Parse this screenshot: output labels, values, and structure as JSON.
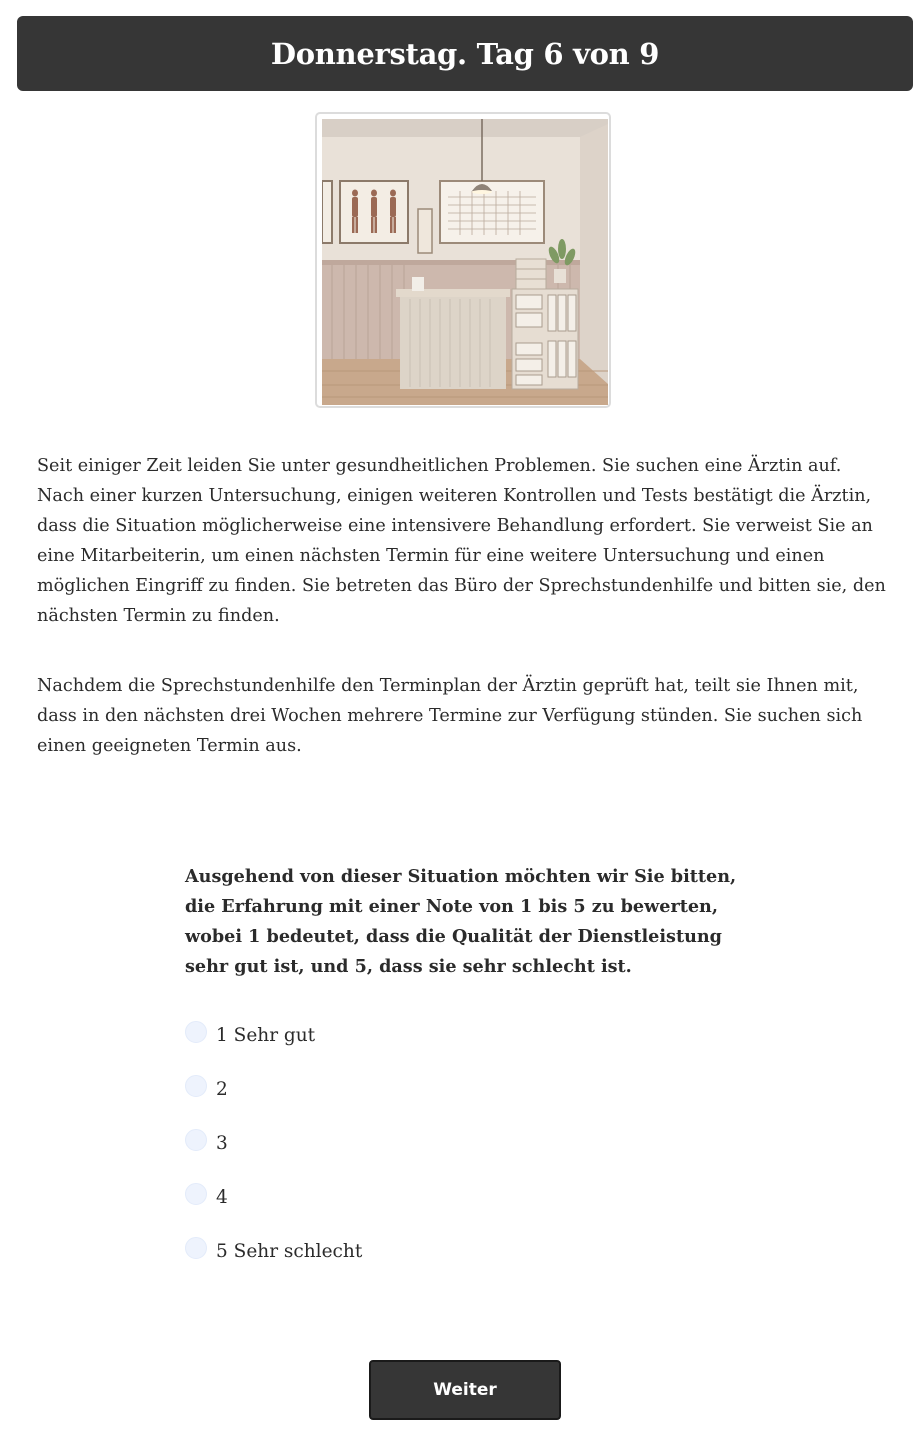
{
  "header": {
    "title": "Donnerstag. Tag 6 von 9"
  },
  "scene_image": {
    "icon": "reception-desk-illustration"
  },
  "story": {
    "paragraphs": [
      "Seit einiger Zeit leiden Sie unter gesundheitlichen Problemen. Sie suchen eine Ärztin auf. Nach einer kurzen Untersuchung, einigen weiteren Kontrollen und Tests bestätigt die Ärztin, dass die Situation möglicherweise eine intensivere Behandlung erfordert. Sie verweist Sie an eine Mitarbeiterin, um einen nächsten Termin für eine weitere Untersuchung und einen möglichen Eingriff zu finden. Sie betreten das Büro der Sprechstundenhilfe und bitten sie, den nächsten Termin zu finden.",
      "Nachdem die Sprechstundenhilfe den Terminplan der Ärztin geprüft hat, teilt sie Ihnen mit, dass in den nächsten drei Wochen mehrere Termine zur Verfügung stünden. Sie suchen sich einen geeigneten Termin aus."
    ]
  },
  "question": {
    "text": "Ausgehend von dieser Situation möchten wir Sie bitten, die Erfahrung mit einer Note von 1 bis 5 zu bewerten, wobei 1 bedeutet, dass die Qualität der Dienstleistung sehr gut ist, und 5, dass sie sehr schlecht ist.",
    "options": [
      {
        "label": "1 Sehr gut"
      },
      {
        "label": "2"
      },
      {
        "label": "3"
      },
      {
        "label": "4"
      },
      {
        "label": "5 Sehr schlecht"
      }
    ]
  },
  "actions": {
    "next_label": "Weiter"
  },
  "colors": {
    "header_bg": "#363636",
    "radio_fill": "#eef3fd",
    "button_bg": "#363636"
  }
}
